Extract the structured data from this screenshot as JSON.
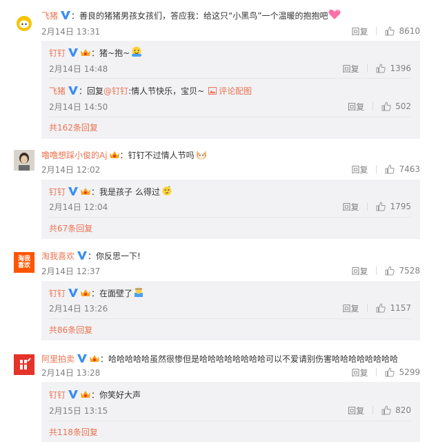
{
  "threads": [
    {
      "comment": {
        "user": "飞猪",
        "text": "善良的猪猪男孩女孩们，答应我：给这只“小黑鸟”一个温暖的抱抱吧",
        "time": "2月14日 13:31",
        "reply_label": "回复",
        "likes": "8610",
        "avatar_icon": "feizhu-pig-logo",
        "emoji_icon": "pink-heart-emoji"
      },
      "replies": [
        {
          "user": "钉钉",
          "text": "猪~抱~",
          "time": "2月14日 14:48",
          "reply_label": "回复",
          "likes": "1396",
          "emoji_icon": "hug-emoji"
        },
        {
          "user": "飞猪",
          "text_prefix": "回复",
          "mention": "@钉钉",
          "text": ":情人节快乐，宝贝~",
          "image_link": "评论配图",
          "time": "2月14日 14:50",
          "reply_label": "回复",
          "likes": "502"
        }
      ],
      "more": "共162条回复"
    },
    {
      "comment": {
        "user": "噜噜想踩小俊的Aj",
        "text": "钉钉不过情人节吗",
        "time": "2月14日 12:02",
        "reply_label": "回复",
        "likes": "7463",
        "avatar_icon": "person-photo-avatar",
        "emoji_icon": "cat-face-emoji"
      },
      "replies": [
        {
          "user": "钉钉",
          "text": "我是孩子 么得过",
          "time": "2月14日 12:04",
          "reply_label": "回复",
          "likes": "1795",
          "emoji_icon": "smug-face-emoji"
        }
      ],
      "more": "共67条回复"
    },
    {
      "comment": {
        "user": "淘我喜欢",
        "text": "你反思一下!",
        "time": "2月14日 12:37",
        "reply_label": "回复",
        "likes": "7528",
        "avatar_icon": "taowoxihuan-logo",
        "avatar_text": "淘我\n喜欢"
      },
      "replies": [
        {
          "user": "钉钉",
          "text": "在面壁了",
          "time": "2月14日 13:26",
          "reply_label": "回复",
          "likes": "1157",
          "emoji_icon": "face-wall-emoji"
        }
      ],
      "more": "共86条回复"
    },
    {
      "comment": {
        "user": "阿里拍卖",
        "text": "哈哈哈哈哈虽然很惨但是哈哈哈哈哈哈哈哈可以不爱请别伤害哈哈哈哈哈哈哈哈",
        "time": "2月14日 13:28",
        "reply_label": "回复",
        "likes": "5299",
        "avatar_icon": "ali-auction-logo"
      },
      "replies": [
        {
          "user": "钉钉",
          "text": "你笑好大声",
          "time": "2月15日 13:15",
          "reply_label": "回复",
          "likes": "820"
        }
      ],
      "more": "共118条回复"
    }
  ],
  "colors": {
    "link": "#eb7350",
    "verified_blue": "#3a8ef0",
    "reply_bg": "#f2f2f5",
    "meta": "#808080"
  }
}
